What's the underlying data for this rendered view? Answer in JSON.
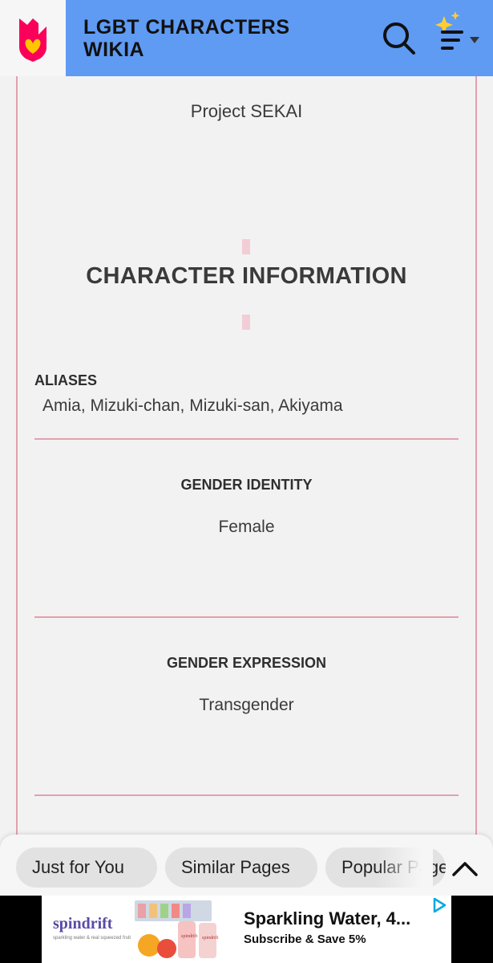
{
  "header": {
    "site_title": "LGBT CHARACTERS WIKIA",
    "logo_icon": "fandom-heart-logo-icon",
    "search_icon": "search-icon",
    "menu_icon": "sparkle-menu-icon",
    "brand_color": "#5f9bf3"
  },
  "infobox": {
    "subtitle": "Project SEKAI",
    "section_title": "CHARACTER INFORMATION",
    "aliases": {
      "label": "ALIASES",
      "value": "Amia, Mizuki-chan, Mizuki-san, Akiyama"
    },
    "gender_identity": {
      "label": "GENDER IDENTITY",
      "value": "Female"
    },
    "gender_expression": {
      "label": "GENDER EXPRESSION",
      "value": "Transgender"
    },
    "accent_color": "#e2a0ad"
  },
  "bottom_bar": {
    "pills": [
      "Just for You",
      "Similar Pages",
      "Popular Pages"
    ],
    "scroll_top_icon": "chevron-up-icon"
  },
  "ad": {
    "brand": "spindrift",
    "tagline": "sparkling water & real squeezed fruit",
    "headline": "Sparkling Water, 4...",
    "subline": "Subscribe & Save 5%",
    "adchoices_icon": "adchoices-icon"
  }
}
